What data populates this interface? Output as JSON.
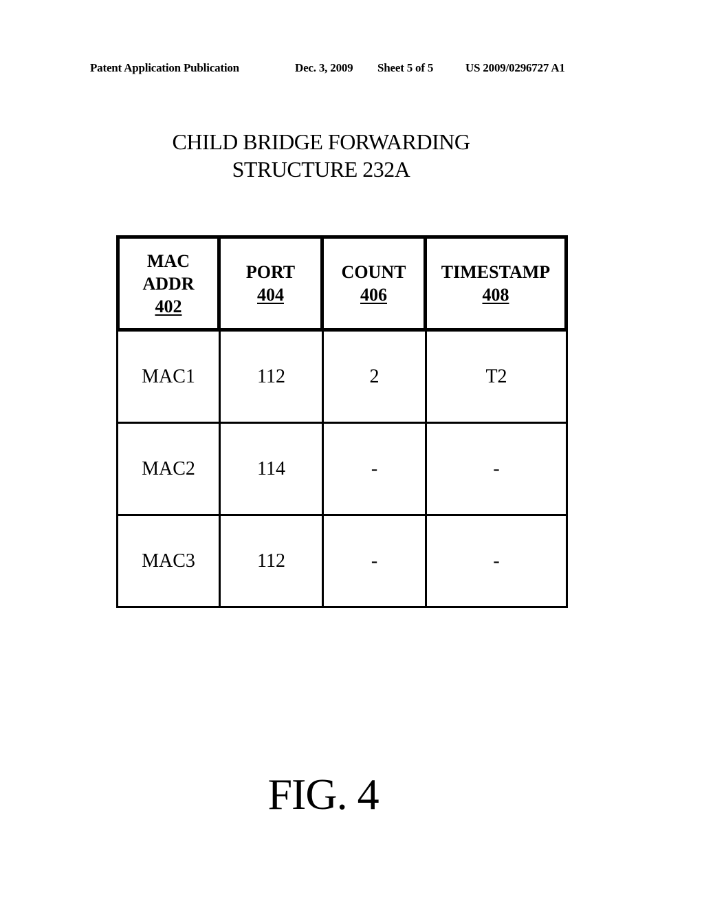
{
  "header": {
    "publication": "Patent Application Publication",
    "date": "Dec. 3, 2009",
    "sheet": "Sheet 5 of 5",
    "number": "US 2009/0296727 A1"
  },
  "title": {
    "line1": "CHILD BRIDGE FORWARDING",
    "line2": "STRUCTURE 232A"
  },
  "table": {
    "columns": [
      {
        "label_lines": [
          "MAC",
          "ADDR"
        ],
        "ref": "402"
      },
      {
        "label_lines": [
          "PORT"
        ],
        "ref": "404"
      },
      {
        "label_lines": [
          "COUNT"
        ],
        "ref": "406"
      },
      {
        "label_lines": [
          "TIMESTAMP"
        ],
        "ref": "408"
      }
    ],
    "rows": [
      [
        "MAC1",
        "112",
        "2",
        "T2"
      ],
      [
        "MAC2",
        "114",
        "-",
        "-"
      ],
      [
        "MAC3",
        "112",
        "-",
        "-"
      ]
    ]
  },
  "figure_label": "FIG. 4"
}
